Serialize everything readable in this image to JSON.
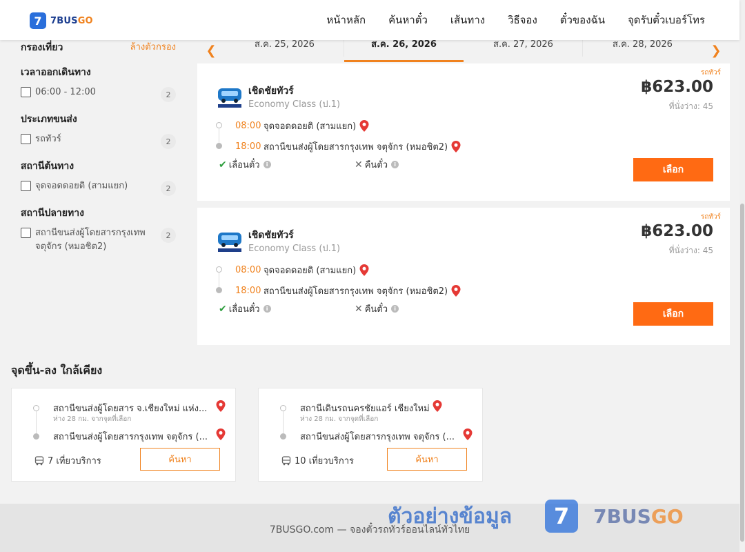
{
  "header": {
    "logo_mark": "7",
    "logo_text_a": "7BUS",
    "logo_text_b": "GO",
    "nav": [
      "หน้าหลัก",
      "ค้นหาตั๋ว",
      "เส้นทาง",
      "วิธีจอง",
      "ตั๋วของฉัน",
      "จุดรับตั๋วเบอร์โทร"
    ]
  },
  "filters": {
    "title": "กรองเที่ยว",
    "clear": "ล้างตัวกรอง",
    "groups": [
      {
        "title": "เวลาออกเดินทาง",
        "option": "06:00 - 12:00",
        "count": "2"
      },
      {
        "title": "ประเภทขนส่ง",
        "option": "รถทัวร์",
        "count": "2"
      },
      {
        "title": "สถานีต้นทาง",
        "option": "จุดจอดดอยติ (สามแยก)",
        "count": "2"
      },
      {
        "title": "สถานีปลายทาง",
        "option": "สถานีขนส่งผู้โดยสารกรุงเทพ จตุจักร (หมอชิต2)",
        "count": "2"
      }
    ]
  },
  "dates": {
    "tabs": [
      "ส.ค. 25, 2026",
      "ส.ค. 26, 2026",
      "ส.ค. 27, 2026",
      "ส.ค. 28, 2026"
    ],
    "active_index": 1,
    "prev_arrow": "❮",
    "next_arrow": "❯"
  },
  "trips": [
    {
      "tag": "รถทัวร์",
      "operator": "เชิดชัยทัวร์",
      "class": "Economy Class (ป.1)",
      "price": "฿623.00",
      "seats": "ที่นั่งว่าง: 45",
      "depart_time": "08:00",
      "depart_station": "จุดจอดดอยติ (สามแยก)",
      "arrive_time": "18:00",
      "arrive_station": "สถานีขนส่งผู้โดยสารกรุงเทพ จตุจักร (หมอชิต2)",
      "reschedule": "เลื่อนตั๋ว",
      "refund": "คืนตั๋ว",
      "select": "เลือก"
    },
    {
      "tag": "รถทัวร์",
      "operator": "เชิดชัยทัวร์",
      "class": "Economy Class (ป.1)",
      "price": "฿623.00",
      "seats": "ที่นั่งว่าง: 45",
      "depart_time": "08:00",
      "depart_station": "จุดจอดดอยติ (สามแยก)",
      "arrive_time": "18:00",
      "arrive_station": "สถานีขนส่งผู้โดยสารกรุงเทพ จตุจักร (หมอชิต2)",
      "reschedule": "เลื่อนตั๋ว",
      "refund": "คืนตั๋ว",
      "select": "เลือก"
    }
  ],
  "nearby": {
    "title": "จุดขึ้น-ลง ใกล้เคียง",
    "cards": [
      {
        "from": "สถานีขนส่งผู้โดยสาร จ.เชียงใหม่ แห่ง...",
        "distance": "ห่าง 28 กม. จากจุดที่เลือก",
        "to": "สถานีขนส่งผู้โดยสารกรุงเทพ จตุจักร (...",
        "trips": "7 เที่ยวบริการ",
        "search": "ค้นหา"
      },
      {
        "from": "สถานีเดินรถนครชัยแอร์ เชียงใหม่",
        "distance": "ห่าง 28 กม. จากจุดที่เลือก",
        "to": "สถานีขนส่งผู้โดยสารกรุงเทพ จตุจักร (...",
        "trips": "10 เที่ยวบริการ",
        "search": "ค้นหา"
      }
    ]
  },
  "footer": {
    "text": "7BUSGO.com — จองตั๋วรถทัวร์ออนไลน์ทั่วไทย"
  },
  "watermark": {
    "text": "ตัวอย่างข้อมูล",
    "logo_mark": "7",
    "brand_a": "7BUS",
    "brand_b": "GO"
  },
  "colors": {
    "accent": "#f0821e",
    "button": "#ff6a13",
    "brand_blue": "#2a6fdb"
  }
}
